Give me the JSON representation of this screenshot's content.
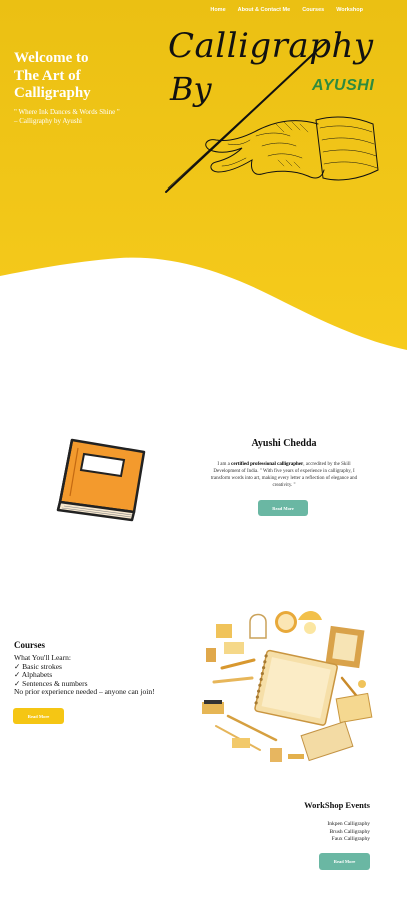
{
  "nav": {
    "items": [
      "Home",
      "About & Contact Me",
      "Courses",
      "Workshop"
    ]
  },
  "hero": {
    "title_line1": "Welcome to",
    "title_line2": "The Art of",
    "title_line3": "Calligraphy",
    "tagline_line1": "\" Where Ink Dances & Words Shine \"",
    "tagline_line2": "– Calligraphy by Ayushi",
    "logo_word1": "Calligraphy",
    "logo_word2": "By",
    "logo_name": "AYUSHI",
    "colors": {
      "yellow": "#f4c615",
      "name_green": "#2e8b3e"
    }
  },
  "about": {
    "name": "Ayushi Chedda",
    "text_before": "I am a",
    "text_bold": "certified professional calligrapher",
    "text_after": ", accredited by the Skill Development of India. \" With five years of experience in calligraphy, I transform words into art, making every letter a reflection of elegance and creativity. \"",
    "button_label": "Read More",
    "button_color": "#6ab7a3"
  },
  "courses": {
    "title": "Courses",
    "intro": "What You'll Learn:",
    "items": [
      "✓ Basic strokes",
      "✓ Alphabets",
      "✓ Sentences & numbers"
    ],
    "note": "No prior experience needed – anyone can join!",
    "button_label": "Read More",
    "button_color": "#f5c614"
  },
  "workshop": {
    "title": "WorkShop Events",
    "items": [
      "Inkpen Calligraphy",
      "Brush Calligraphy",
      "Faux Calligraphy"
    ],
    "button_label": "Read More"
  }
}
